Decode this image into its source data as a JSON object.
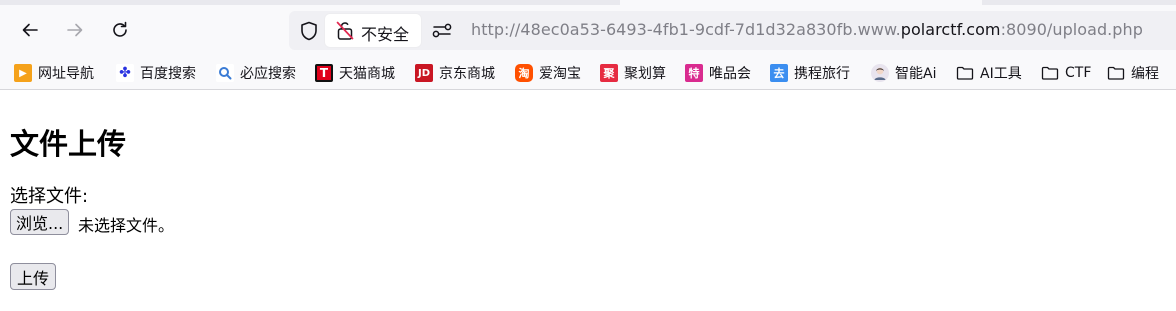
{
  "toolbar": {
    "identity_label": "不安全",
    "url_prefix": "http://",
    "url_subdomain": "48ec0a53-6493-4fb1-9cdf-7d1d32a830fb.www.",
    "url_host": "polarctf.com",
    "url_suffix": ":8090/upload.php"
  },
  "bookmarks": [
    {
      "label": "网址导航",
      "icon": "navigation-flag-icon",
      "color": "#f5a21b",
      "glyph": "▶"
    },
    {
      "label": "百度搜索",
      "icon": "baidu-paw-icon",
      "color": "#2932e1",
      "glyph": "🐾"
    },
    {
      "label": "必应搜索",
      "icon": "search-icon",
      "color": "#3a7bd5",
      "glyph": "Q"
    },
    {
      "label": "天猫商城",
      "icon": "tmall-icon",
      "color": "#e0001b",
      "glyph": "T"
    },
    {
      "label": "京东商城",
      "icon": "jd-icon",
      "color": "#c91623",
      "glyph": "JD"
    },
    {
      "label": "爱淘宝",
      "icon": "taobao-icon",
      "color": "#ff5000",
      "glyph": "淘"
    },
    {
      "label": "聚划算",
      "icon": "juhuasuan-icon",
      "color": "#e62b41",
      "glyph": "聚"
    },
    {
      "label": "唯品会",
      "icon": "vipshop-icon",
      "color": "#d92b8f",
      "glyph": "特"
    },
    {
      "label": "携程旅行",
      "icon": "ctrip-icon",
      "color": "#3b8ef0",
      "glyph": "去"
    },
    {
      "label": "智能Ai",
      "icon": "ai-avatar-icon",
      "color": "#c9c3d6",
      "glyph": "☺"
    },
    {
      "label": "AI工具",
      "icon": "folder-icon",
      "color": "",
      "glyph": ""
    },
    {
      "label": "CTF",
      "icon": "folder-icon",
      "color": "",
      "glyph": ""
    },
    {
      "label": "编程",
      "icon": "folder-icon",
      "color": "",
      "glyph": ""
    }
  ],
  "page": {
    "title": "文件上传",
    "choose_label": "选择文件:",
    "browse_button": "浏览...",
    "no_file_text": "未选择文件。",
    "upload_button": "上传"
  }
}
